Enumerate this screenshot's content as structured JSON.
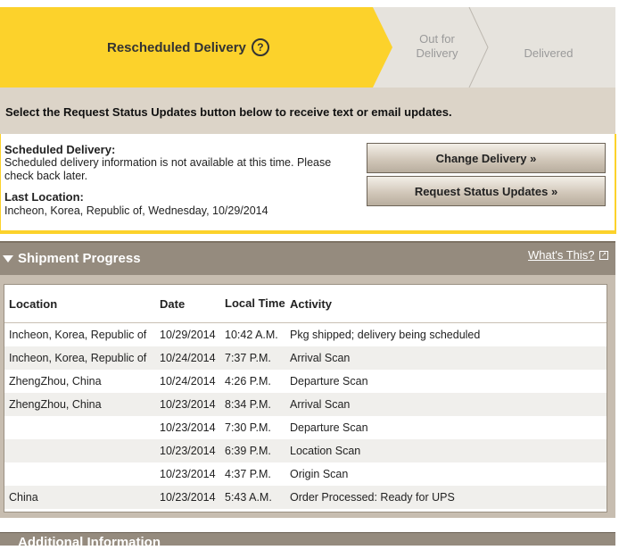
{
  "progress": {
    "current_step": "Rescheduled Delivery",
    "help_glyph": "?",
    "out_for_delivery_line1": "Out for",
    "out_for_delivery_line2": "Delivery",
    "delivered": "Delivered",
    "accent_color": "#fcd22b"
  },
  "info_text": "Select the Request Status Updates button below to receive text or email updates.",
  "delivery": {
    "scheduled_label": "Scheduled Delivery:",
    "scheduled_text": "Scheduled delivery information is not available at this time. Please check back later.",
    "last_location_label": "Last Location:",
    "last_location_text": "Incheon, Korea, Republic of, Wednesday, 10/29/2014"
  },
  "buttons": {
    "change_delivery": "Change Delivery »",
    "request_updates": "Request Status Updates »"
  },
  "shipment": {
    "title": "Shipment Progress",
    "whats_this": "What's This?",
    "columns": [
      "Location",
      "Date",
      "Local Time",
      "Activity"
    ],
    "rows": [
      {
        "location": "Incheon, Korea, Republic of",
        "date": "10/29/2014",
        "time": "10:42 A.M.",
        "activity": "Pkg shipped; delivery being scheduled"
      },
      {
        "location": "Incheon, Korea, Republic of",
        "date": "10/24/2014",
        "time": "7:37 P.M.",
        "activity": "Arrival Scan"
      },
      {
        "location": "ZhengZhou, China",
        "date": "10/24/2014",
        "time": "4:26 P.M.",
        "activity": "Departure Scan"
      },
      {
        "location": "ZhengZhou, China",
        "date": "10/23/2014",
        "time": "8:34 P.M.",
        "activity": "Arrival Scan"
      },
      {
        "location": "",
        "date": "10/23/2014",
        "time": "7:30 P.M.",
        "activity": "Departure Scan"
      },
      {
        "location": "",
        "date": "10/23/2014",
        "time": "6:39 P.M.",
        "activity": "Location Scan"
      },
      {
        "location": "",
        "date": "10/23/2014",
        "time": "4:37 P.M.",
        "activity": "Origin Scan"
      },
      {
        "location": "China",
        "date": "10/23/2014",
        "time": "5:43 A.M.",
        "activity": "Order Processed: Ready for UPS"
      }
    ]
  },
  "next_section": "Additional Information"
}
